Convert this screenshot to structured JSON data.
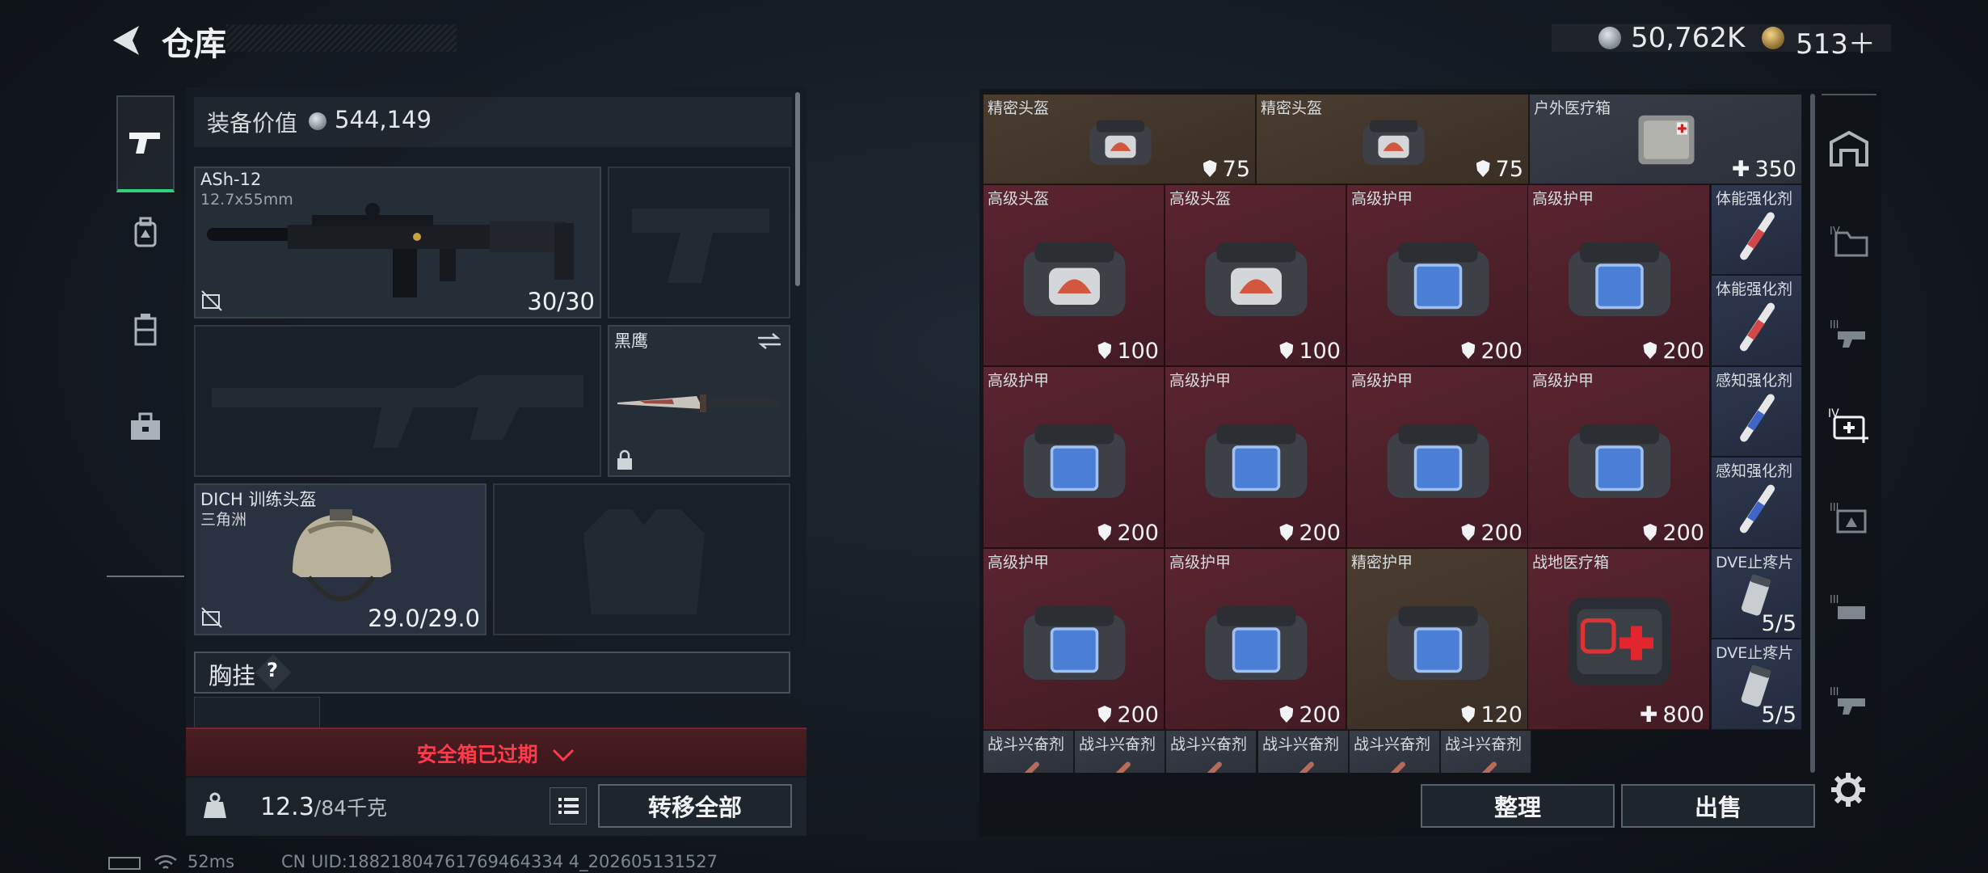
{
  "header": {
    "title": "仓库",
    "currency_silver": "50,762K",
    "currency_gold": "513＋"
  },
  "left_nav": [
    {
      "name": "weapons-icon",
      "active": true
    },
    {
      "name": "backpack-icon",
      "active": false
    },
    {
      "name": "rig-icon",
      "active": false
    },
    {
      "name": "case-icon",
      "active": false
    }
  ],
  "equipment": {
    "value_label": "装备价值",
    "value": "544,149",
    "primary": {
      "name": "ASh-12",
      "ammo": "12.7x55mm",
      "count": "30/30"
    },
    "melee": {
      "name": "黑鹰"
    },
    "helmet": {
      "name": "DICH 训练头盔",
      "map": "三角洲",
      "durability": "29.0/29.0"
    },
    "vest_label": "胸挂",
    "vest_help": "?",
    "safebox_expired": "安全箱已过期",
    "weight": "12.3",
    "weight_max": "/84千克",
    "transfer_all": "转移全部"
  },
  "stash": {
    "cells": [
      {
        "name": "精密头盔",
        "value": "75",
        "kind": "shield"
      },
      {
        "name": "精密头盔",
        "value": "75",
        "kind": "shield"
      },
      {
        "name": "户外医疗箱",
        "value": "350",
        "kind": "plus"
      },
      {
        "name": "高级头盔",
        "value": "100",
        "kind": "shield"
      },
      {
        "name": "高级头盔",
        "value": "100",
        "kind": "shield"
      },
      {
        "name": "高级护甲",
        "value": "200",
        "kind": "shield"
      },
      {
        "name": "高级护甲",
        "value": "200",
        "kind": "shield"
      },
      {
        "name": "体能强化剂",
        "value": "",
        "kind": ""
      },
      {
        "name": "体能强化剂",
        "value": "",
        "kind": ""
      },
      {
        "name": "高级护甲",
        "value": "200",
        "kind": "shield"
      },
      {
        "name": "高级护甲",
        "value": "200",
        "kind": "shield"
      },
      {
        "name": "高级护甲",
        "value": "200",
        "kind": "shield"
      },
      {
        "name": "高级护甲",
        "value": "200",
        "kind": "shield"
      },
      {
        "name": "感知强化剂",
        "value": "",
        "kind": ""
      },
      {
        "name": "感知强化剂",
        "value": "",
        "kind": ""
      },
      {
        "name": "高级护甲",
        "value": "200",
        "kind": "shield"
      },
      {
        "name": "高级护甲",
        "value": "200",
        "kind": "shield"
      },
      {
        "name": "精密护甲",
        "value": "120",
        "kind": "shield"
      },
      {
        "name": "战地医疗箱",
        "value": "800",
        "kind": "plus"
      },
      {
        "name": "DVE止疼片",
        "value": "5/5",
        "kind": ""
      },
      {
        "name": "DVE止疼片",
        "value": "5/5",
        "kind": ""
      },
      {
        "name": "战斗兴奋剂",
        "value": "",
        "kind": ""
      },
      {
        "name": "战斗兴奋剂",
        "value": "",
        "kind": ""
      },
      {
        "name": "战斗兴奋剂",
        "value": "",
        "kind": ""
      },
      {
        "name": "战斗兴奋剂",
        "value": "",
        "kind": ""
      },
      {
        "name": "战斗兴奋剂",
        "value": "",
        "kind": ""
      },
      {
        "name": "战斗兴奋剂",
        "value": "",
        "kind": ""
      }
    ],
    "sort_label": "整理",
    "sell_label": "出售"
  },
  "status_bar": {
    "ping": "52ms",
    "uid": "CN UID:18821804761769464334 4_202605131527"
  }
}
